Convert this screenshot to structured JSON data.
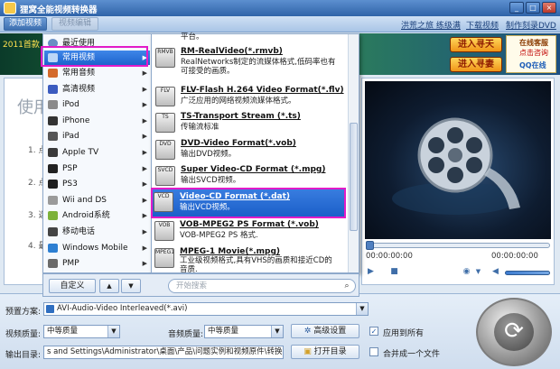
{
  "window": {
    "title": "狸窝全能视频转换器",
    "minimize": "_",
    "maximize": "□",
    "close": "×"
  },
  "toolbar": {
    "add_video": "添加视频",
    "edit_video": "视频编辑"
  },
  "top_links": [
    "洪荒之旅 练级满",
    "下载视频",
    "制作刻录DVD"
  ],
  "banner": {
    "year_text": "2011首款",
    "game_btn_1": "进入寻天",
    "game_btn_2": "进入寻妻",
    "promo_line_1": "在线客服",
    "promo_line_2": "点击咨询",
    "promo_line_3": "QQ在线"
  },
  "main": {
    "usage_title": "使用",
    "steps": [
      "1. 点",
      "2. 点",
      "3. 选",
      "4. 最"
    ]
  },
  "category_menu": [
    {
      "label": "最近使用",
      "color": "#6a8fc4"
    },
    {
      "label": "常用视频",
      "color": "#3a7be0"
    },
    {
      "label": "常用音频",
      "color": "#d46a2b"
    },
    {
      "label": "高清视频",
      "color": "#3b5bbf"
    },
    {
      "label": "iPod",
      "color": "#8a8a8a"
    },
    {
      "label": "iPhone",
      "color": "#333333"
    },
    {
      "label": "iPad",
      "color": "#555555"
    },
    {
      "label": "Apple TV",
      "color": "#3a3a3a"
    },
    {
      "label": "PSP",
      "color": "#222222"
    },
    {
      "label": "PS3",
      "color": "#1f1f1f"
    },
    {
      "label": "Wii and DS",
      "color": "#9a9a9a"
    },
    {
      "label": "Android系统",
      "color": "#7db23a"
    },
    {
      "label": "移动电话",
      "color": "#444444"
    },
    {
      "label": "Windows Mobile",
      "color": "#2d7fd2"
    },
    {
      "label": "PMP",
      "color": "#6a6a6a"
    }
  ],
  "format_menu": [
    {
      "icon": "",
      "title": "",
      "desc": "平台。"
    },
    {
      "icon": "RMVB",
      "title": "RM-RealVideo(*.rmvb)",
      "desc": "RealNetworks制定的流媒体格式,低码率也有\n可接受的画质。"
    },
    {
      "icon": "FLV",
      "title": "FLV-Flash H.264 Video Format(*.flv)",
      "desc": "广泛应用的网络视频流媒体格式。"
    },
    {
      "icon": "TS",
      "title": "TS-Transport Stream (*.ts)",
      "desc": "传输流标准"
    },
    {
      "icon": "DVD",
      "title": "DVD-Video Format(*.vob)",
      "desc": "输出DVD视频。"
    },
    {
      "icon": "SVCD",
      "title": "Super Video-CD Format (*.mpg)",
      "desc": "输出SVCD视频。"
    },
    {
      "icon": "VCD",
      "title": "Video-CD Format (*.dat)",
      "desc": "输出VCD视频。"
    },
    {
      "icon": "VOB",
      "title": "VOB-MPEG2 PS Format (*.vob)",
      "desc": "VOB-MPEG2 PS 格式."
    },
    {
      "icon": "MPEG1",
      "title": "MPEG-1 Movie(*.mpg)",
      "desc": "工业级视频格式,具有VHS的画质和接近CD的\n音质."
    }
  ],
  "menu_footer": {
    "custom_btn": "自定义",
    "search_placeholder": "开始搜索"
  },
  "preview": {
    "time_left": "00:00:00:00",
    "time_right": "00:00:00:00"
  },
  "bottom": {
    "preset_label": "预置方案:",
    "preset_value": "AVI-Audio-Video Interleaved(*.avi)",
    "video_quality_label": "视频质量:",
    "video_quality_value": "中等质量",
    "audio_quality_label": "音频质量:",
    "audio_quality_value": "中等质量",
    "advanced_btn": "高级设置",
    "apply_all_label": "应用到所有",
    "output_label": "输出目录:",
    "output_path": "s and Settings\\Administrator\\桌面\\产品\\问题实例和视频原件\\转换",
    "open_dir_btn": "打开目录",
    "merge_label": "合并成一个文件"
  }
}
